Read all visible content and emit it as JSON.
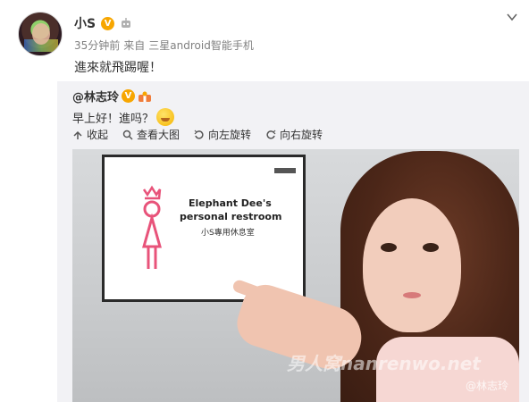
{
  "post": {
    "author": "小S",
    "time": "35分钟前",
    "source_prefix": "来自",
    "source": "三星android智能手机",
    "text": "進來就飛踢喔！"
  },
  "quoted": {
    "author": "@林志玲",
    "text": "早上好！進吗？",
    "actions": {
      "collect": "收起",
      "view_large": "查看大图",
      "rotate_left": "向左旋转",
      "rotate_right": "向右旋转"
    },
    "photo": {
      "sign_line1": "Elephant Dee's",
      "sign_line2": "personal restroom",
      "sign_sub": "小S專用休息室",
      "watermark": "男人窝nanrenwo.net",
      "credit": "@林志玲"
    }
  },
  "icons": [
    "vip-badge-icon",
    "robot-icon",
    "chevron-down-icon",
    "collapse-icon",
    "search-icon",
    "rotate-left-icon",
    "rotate-right-icon",
    "smiley-emoji-icon"
  ],
  "colors": {
    "vip": "#f7a600",
    "quote_bg": "#f2f2f5",
    "meta": "#808080",
    "sign_pink": "#e8537a"
  }
}
